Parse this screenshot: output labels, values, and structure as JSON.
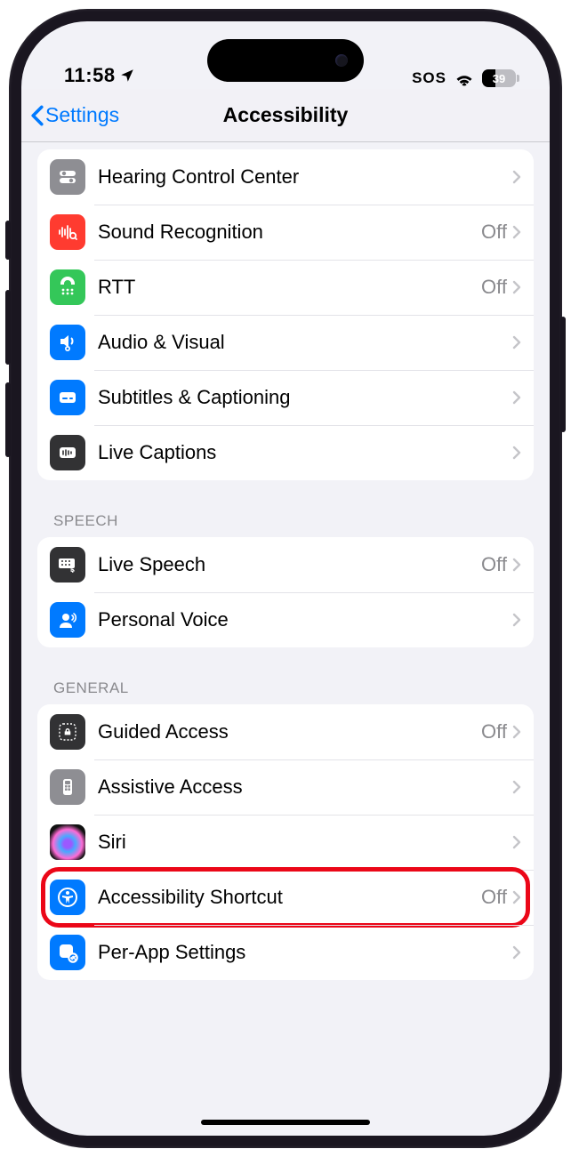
{
  "status": {
    "time": "11:58",
    "sos": "SOS",
    "battery": "39"
  },
  "nav": {
    "back": "Settings",
    "title": "Accessibility"
  },
  "sections": {
    "s1": {
      "hearing_control": "Hearing Control Center",
      "sound_recognition": "Sound Recognition",
      "sound_recognition_val": "Off",
      "rtt": "RTT",
      "rtt_val": "Off",
      "audio_visual": "Audio & Visual",
      "subtitles": "Subtitles & Captioning",
      "live_captions": "Live Captions"
    },
    "s2_header": "Speech",
    "s2": {
      "live_speech": "Live Speech",
      "live_speech_val": "Off",
      "personal_voice": "Personal Voice"
    },
    "s3_header": "General",
    "s3": {
      "guided_access": "Guided Access",
      "guided_access_val": "Off",
      "assistive_access": "Assistive Access",
      "siri": "Siri",
      "accessibility_shortcut": "Accessibility Shortcut",
      "accessibility_shortcut_val": "Off",
      "per_app": "Per-App Settings"
    }
  }
}
